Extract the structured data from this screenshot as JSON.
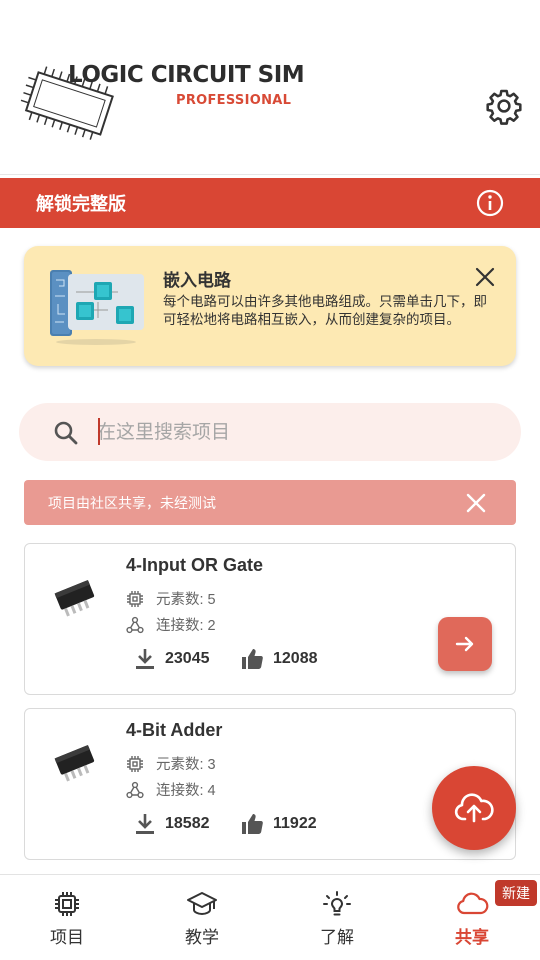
{
  "header": {
    "logo_title": "LOGIC CIRCUIT SIM",
    "logo_subtitle": "PROFESSIONAL",
    "settings_icon": "gear-icon"
  },
  "unlock_bar": {
    "label": "解锁完整版",
    "info_icon": "info-icon"
  },
  "tip": {
    "title": "嵌入电路",
    "text": "每个电路可以由许多其他电路组成。只需单击几下，即可轻松地将电路相互嵌入，从而创建复杂的项目。"
  },
  "search": {
    "placeholder": "在这里搜索项目",
    "value": ""
  },
  "warning": {
    "text": "项目由社区共享，未经测试"
  },
  "projects": [
    {
      "title": "4-Input OR Gate",
      "elements": "元素数: 5",
      "connections": "连接数: 2",
      "downloads": "23045",
      "likes": "12088"
    },
    {
      "title": "4-Bit Adder",
      "elements": "元素数: 3",
      "connections": "连接数: 4",
      "downloads": "18582",
      "likes": "11922"
    }
  ],
  "fab": {
    "icon": "cloud-upload-icon"
  },
  "bottom_nav": {
    "items": [
      {
        "label": "项目",
        "icon": "chip-icon"
      },
      {
        "label": "教学",
        "icon": "graduation-cap-icon"
      },
      {
        "label": "了解",
        "icon": "lightbulb-icon"
      },
      {
        "label": "共享",
        "icon": "cloud-icon"
      }
    ],
    "active_index": 3,
    "badge": "新建"
  },
  "colors": {
    "accent": "#d94634",
    "tip_background": "#fde9b3",
    "warning_background": "#e99a92",
    "search_background": "#fceeeb"
  }
}
